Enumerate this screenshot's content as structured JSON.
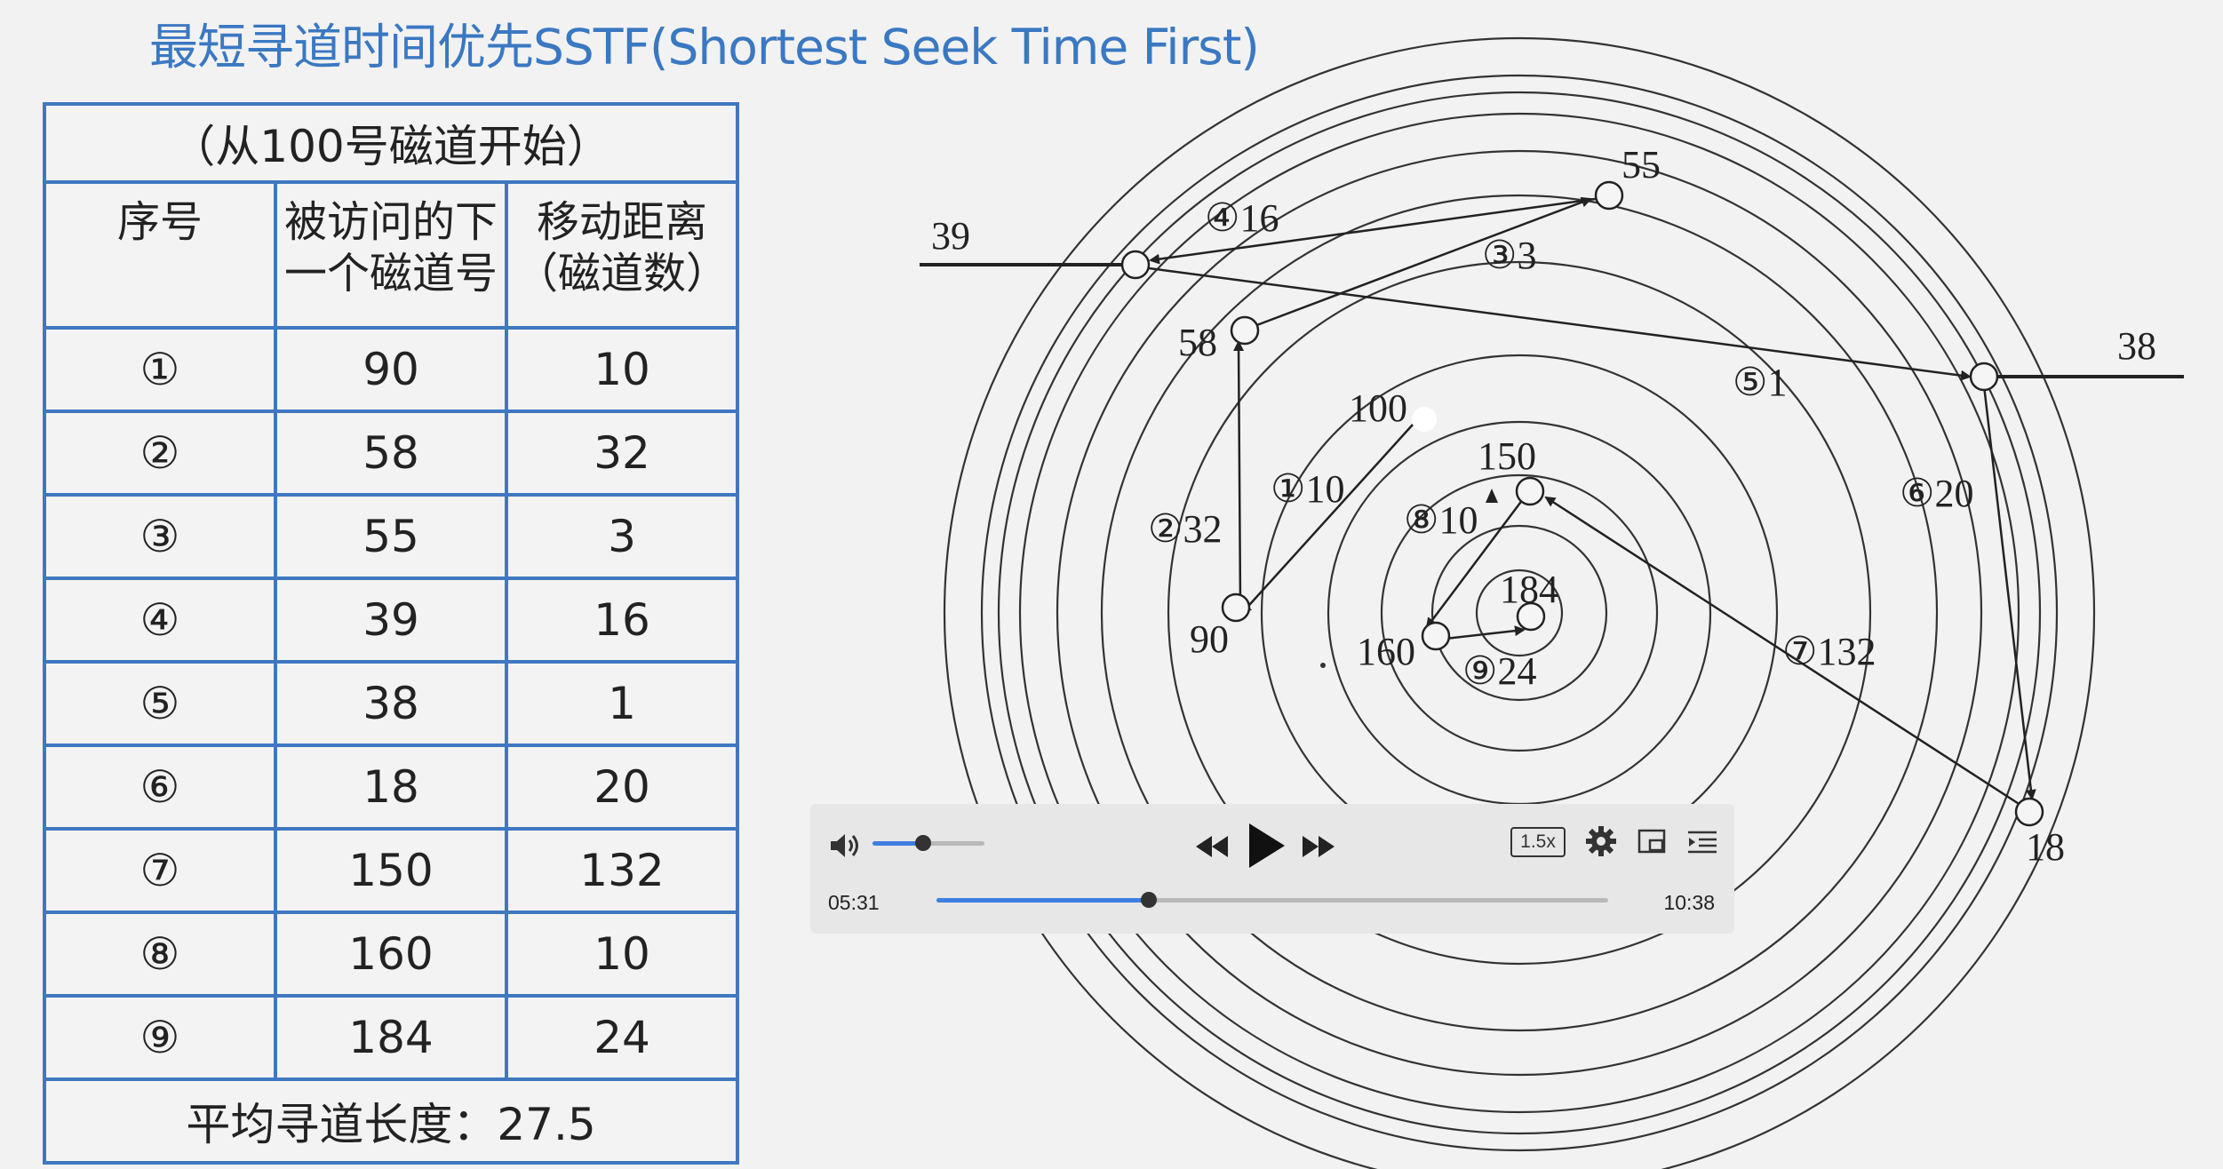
{
  "title": "最短寻道时间优先SSTF(Shortest Seek Time First)",
  "table": {
    "caption": "（从100号磁道开始）",
    "headers": [
      "序号",
      "被访问的下|一个磁道号",
      "移动距离|（磁道数）"
    ],
    "rows": [
      {
        "seq": "①",
        "track": "90",
        "dist": "10"
      },
      {
        "seq": "②",
        "track": "58",
        "dist": "32"
      },
      {
        "seq": "③",
        "track": "55",
        "dist": "3"
      },
      {
        "seq": "④",
        "track": "39",
        "dist": "16"
      },
      {
        "seq": "⑤",
        "track": "38",
        "dist": "1"
      },
      {
        "seq": "⑥",
        "track": "18",
        "dist": "20"
      },
      {
        "seq": "⑦",
        "track": "150",
        "dist": "132"
      },
      {
        "seq": "⑧",
        "track": "160",
        "dist": "10"
      },
      {
        "seq": "⑨",
        "track": "184",
        "dist": "24"
      }
    ],
    "footer": "平均寻道长度：27.5"
  },
  "diagram": {
    "track_labels": {
      "t39": "39",
      "t55": "55",
      "t38": "38",
      "t58": "58",
      "t100": "100",
      "t150": "150",
      "t184": "184",
      "t90": "90",
      "t160": "160",
      "t18": "18"
    },
    "move_labels": {
      "m1": "①10",
      "m2": "②32",
      "m3": "③3",
      "m4": "④16",
      "m5": "⑤1",
      "m6": "⑥20",
      "m7": "⑦132",
      "m8": "⑧10",
      "m9": "⑨24"
    }
  },
  "player": {
    "current_time": "05:31",
    "total_time": "10:38",
    "speed": "1.5x",
    "volume": 0.45,
    "progress": 0.3165
  },
  "colors": {
    "accent": "#3e7fe0",
    "table_border": "#3f78c0",
    "title": "#3a78c2"
  },
  "icons": {
    "volume": "volume-icon",
    "rewind": "rewind-icon",
    "play": "play-icon",
    "forward": "fast-forward-icon",
    "settings": "gear-icon",
    "pip": "picture-in-picture-icon",
    "playlist": "playlist-icon"
  }
}
